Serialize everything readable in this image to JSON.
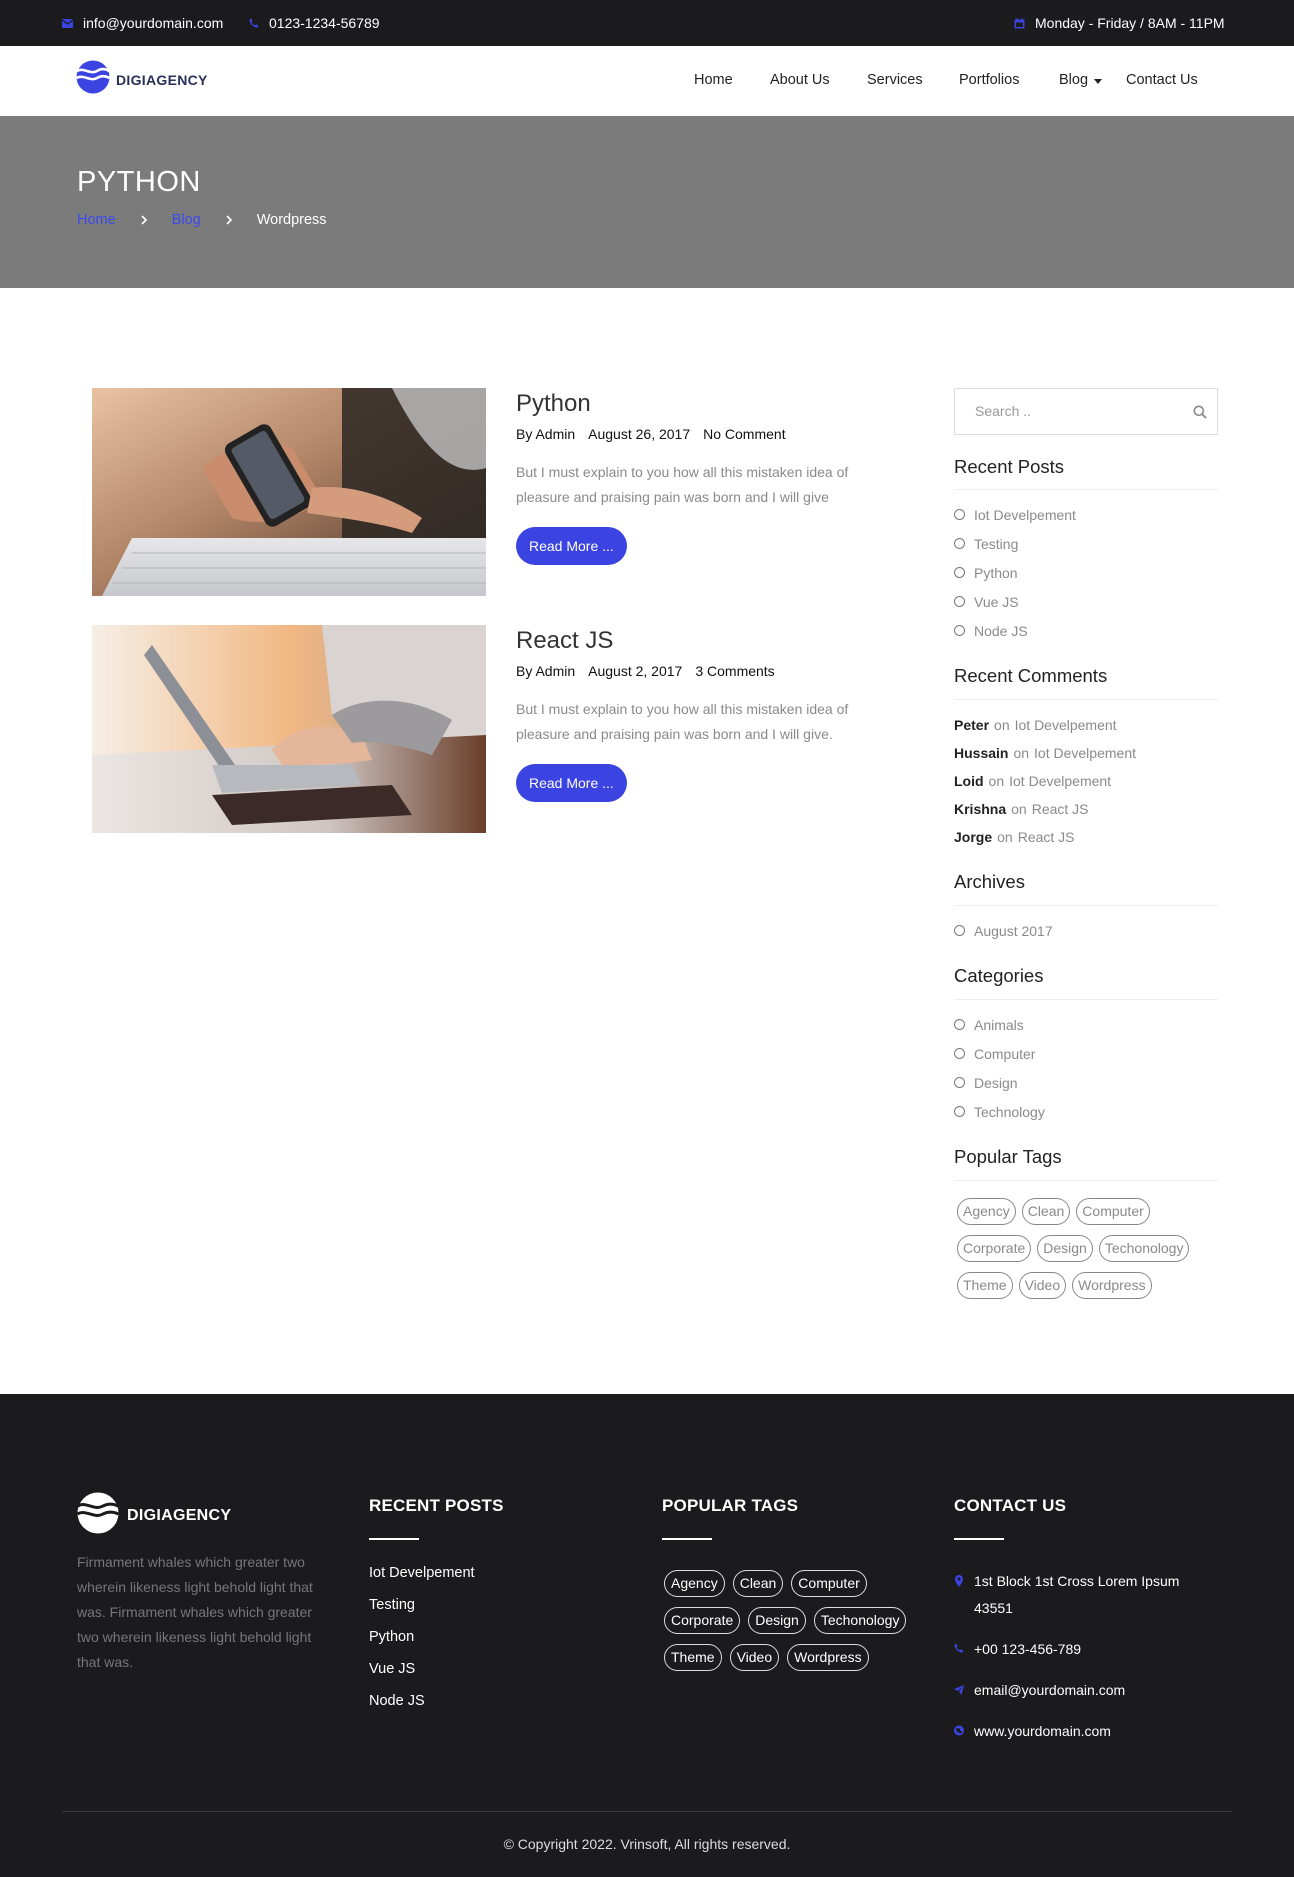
{
  "topbar": {
    "email": "info@yourdomain.com",
    "phone": "0123-1234-56789",
    "hours": "Monday - Friday / 8AM - 11PM"
  },
  "header": {
    "logo": "DIGIAGENCY",
    "nav": [
      "Home",
      "About Us",
      "Services",
      "Portfolios",
      "Blog",
      "Contact Us"
    ]
  },
  "banner": {
    "title": "PYTHON",
    "breadcrumb": [
      "Home",
      "Blog",
      "Wordpress"
    ]
  },
  "posts": [
    {
      "title": "Python",
      "author": "By Admin",
      "date": "August 26, 2017",
      "comments": "No Comment",
      "excerpt": "But I must explain to you how all this mistaken idea of pleasure and praising pain was born and I will give",
      "button": "Read More ..."
    },
    {
      "title": "React JS",
      "author": "By Admin",
      "date": "August 2, 2017",
      "comments": "3 Comments",
      "excerpt": "But I must explain to you how all this mistaken idea of pleasure and praising pain was born and I will give.",
      "button": "Read More ..."
    }
  ],
  "sidebar": {
    "search_placeholder": "Search ..",
    "recent_posts": {
      "title": "Recent Posts",
      "items": [
        "Iot Develpement",
        "Testing",
        "Python",
        "Vue JS",
        "Node JS"
      ]
    },
    "recent_comments": {
      "title": "Recent Comments",
      "on_word": "on",
      "items": [
        {
          "author": "Peter",
          "post": "Iot Develpement"
        },
        {
          "author": "Hussain",
          "post": "Iot Develpement"
        },
        {
          "author": "Loid",
          "post": "Iot Develpement"
        },
        {
          "author": "Krishna",
          "post": "React JS"
        },
        {
          "author": "Jorge",
          "post": "React JS"
        }
      ]
    },
    "archives": {
      "title": "Archives",
      "items": [
        "August 2017"
      ]
    },
    "categories": {
      "title": "Categories",
      "items": [
        "Animals",
        "Computer",
        "Design",
        "Technology"
      ]
    },
    "tags": {
      "title": "Popular Tags",
      "items": [
        "Agency",
        "Clean",
        "Computer",
        "Corporate",
        "Design",
        "Techonology",
        "Theme",
        "Video",
        "Wordpress"
      ]
    }
  },
  "footer": {
    "logo": "DIGIAGENCY",
    "about": "Firmament whales which greater two wherein likeness light behold light that was. Firmament whales which greater two wherein likeness light behold light that was.",
    "recent_posts": {
      "title": "RECENT POSTS",
      "items": [
        "Iot Develpement",
        "Testing",
        "Python",
        "Vue JS",
        "Node JS"
      ]
    },
    "popular_tags": {
      "title": "POPULAR TAGS",
      "items": [
        "Agency",
        "Clean",
        "Computer",
        "Corporate",
        "Design",
        "Techonology",
        "Theme",
        "Video",
        "Wordpress"
      ]
    },
    "contact": {
      "title": "CONTACT US",
      "address": "1st Block 1st Cross Lorem Ipsum 43551",
      "phone": "+00 123-456-789",
      "email": "email@yourdomain.com",
      "website": "www.yourdomain.com"
    },
    "copyright": "© Copyright 2022. Vrinsoft, All rights reserved."
  },
  "colors": {
    "accent": "#3b43e0",
    "dark": "#1b1b1d",
    "banner": "#7b7b7b"
  }
}
